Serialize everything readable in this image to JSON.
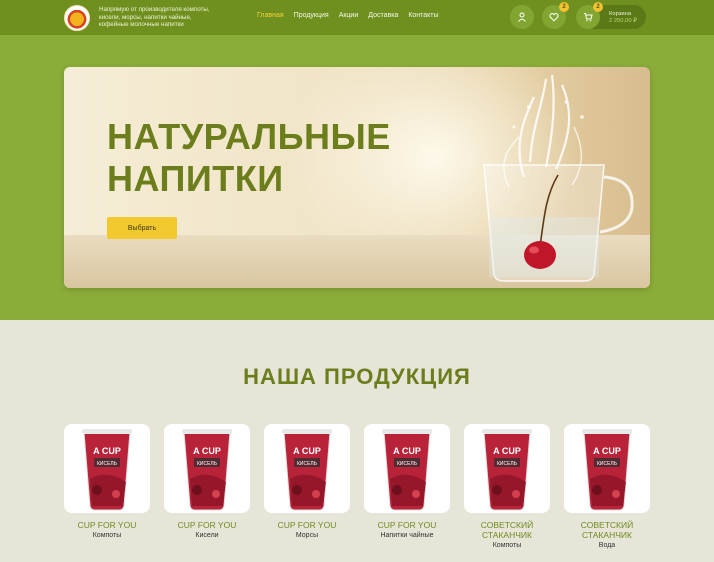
{
  "header": {
    "tagline": "Напрямую от производителя компоты, кисели, морсы, напитки чайные, кофейные молочные напитки",
    "nav": [
      {
        "label": "Главная",
        "active": true
      },
      {
        "label": "Продукция",
        "active": false
      },
      {
        "label": "Акции",
        "active": false
      },
      {
        "label": "Доставка",
        "active": false
      },
      {
        "label": "Контакты",
        "active": false
      }
    ],
    "favorites_count": "2",
    "cart_count": "2",
    "cart_label": "Корзина",
    "cart_sum": "2 250,00 ₽"
  },
  "hero": {
    "title_line1": "НАТУРАЛЬНЫЕ",
    "title_line2": "НАПИТКИ",
    "button": "Выбрать"
  },
  "products_section": {
    "title": "НАША ПРОДУКЦИЯ",
    "items": [
      {
        "name": "CUP FOR YOU",
        "category": "Компоты"
      },
      {
        "name": "CUP FOR YOU",
        "category": "Кисели"
      },
      {
        "name": "CUP FOR YOU",
        "category": "Морсы"
      },
      {
        "name": "CUP FOR YOU",
        "category": "Напитки чайные"
      },
      {
        "name": "СОВЕТСКИЙ СТАКАНЧИК",
        "category": "Компоты"
      },
      {
        "name": "СОВЕТСКИЙ СТАКАНЧИК",
        "category": "Вода"
      }
    ],
    "cup_label": "A CUP",
    "cup_sublabel": "КИСЕЛЬ"
  },
  "colors": {
    "header_bg": "#6f901f",
    "hero_band": "#8aac38",
    "accent_yellow": "#f1c82d",
    "title_green": "#6c7e1c"
  }
}
